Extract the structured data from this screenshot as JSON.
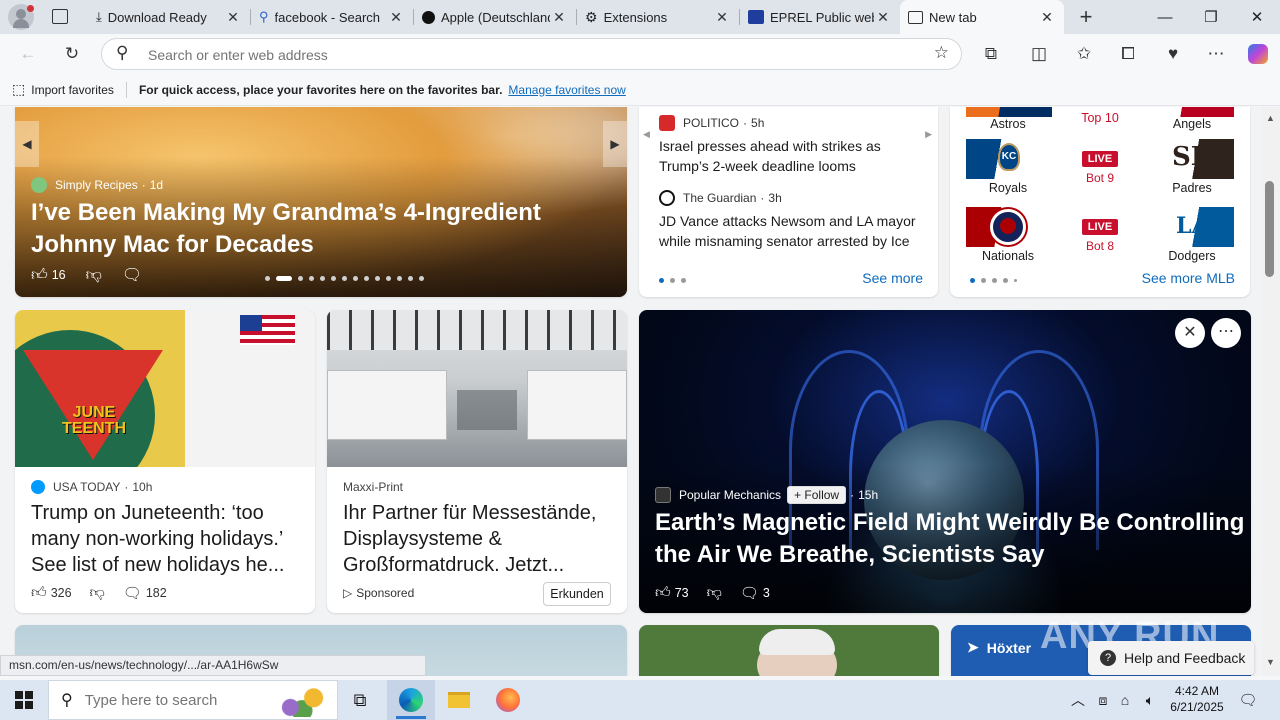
{
  "tabs": [
    {
      "title": "Download Ready",
      "icon": "download-icon"
    },
    {
      "title": "facebook - Search",
      "icon": "search-icon"
    },
    {
      "title": "Apple (Deutschland)",
      "icon": "apple-icon"
    },
    {
      "title": "Extensions",
      "icon": "puzzle-icon"
    },
    {
      "title": "EPREL Public website",
      "icon": "eu-flag-icon"
    },
    {
      "title": "New tab",
      "icon": "newtab-icon",
      "active": true
    }
  ],
  "address_bar": {
    "placeholder": "Search or enter web address"
  },
  "favorites_bar": {
    "import_label": "Import favorites",
    "message": "For quick access, place your favorites here on the favorites bar.",
    "manage_link": "Manage favorites now"
  },
  "hero": {
    "source": "Simply Recipes",
    "age": "1d",
    "title": "I’ve Been Making My Grandma’s 4-Ingredient Johnny Mac for Decades",
    "likes": "16",
    "slide_count": 14,
    "active_slide": 1
  },
  "news_list": {
    "items": [
      {
        "source": "POLITICO",
        "age": "5h",
        "title": "Israel presses ahead with strikes as Trump’s 2-week deadline looms"
      },
      {
        "source": "The Guardian",
        "age": "3h",
        "title": "JD Vance attacks Newsom and LA mayor while misnaming senator arrested by Ice"
      }
    ],
    "see_more": "See more"
  },
  "mlb": {
    "top_row": {
      "left": "Astros",
      "mid": "Top 10",
      "right": "Angels"
    },
    "games": [
      {
        "left": "Royals",
        "status": "LIVE",
        "inning": "Bot 9",
        "right": "Padres"
      },
      {
        "left": "Nationals",
        "status": "LIVE",
        "inning": "Bot 8",
        "right": "Dodgers"
      }
    ],
    "see_more": "See more MLB"
  },
  "cards": [
    {
      "source": "USA TODAY",
      "age": "10h",
      "title": "Trump on Juneteenth: ‘too many non-working holidays.’ See list of new holidays he...",
      "likes": "326",
      "comments": "182",
      "image_text": "JUNE TEENTH"
    },
    {
      "source": "Maxxi-Print",
      "title": "Ihr Partner für Messestände, Displaysysteme & Großformatdruck. Jetzt...",
      "sponsored": "Sponsored",
      "cta": "Erkunden"
    }
  ],
  "feature": {
    "source": "Popular Mechanics",
    "follow": "Follow",
    "age": "15h",
    "title": "Earth’s Magnetic Field Might Weirdly Be Controlling the Air We Breathe, Scientists Say",
    "likes": "73",
    "comments": "3"
  },
  "weather_chip": {
    "location": "Höxter"
  },
  "help": {
    "label": "Help and Feedback"
  },
  "watermark": "ANY RUN",
  "status_url": "msn.com/en-us/news/technology/.../ar-AA1H6wSw",
  "taskbar": {
    "search_placeholder": "Type here to search",
    "time": "4:42 AM",
    "date": "6/21/2025"
  }
}
